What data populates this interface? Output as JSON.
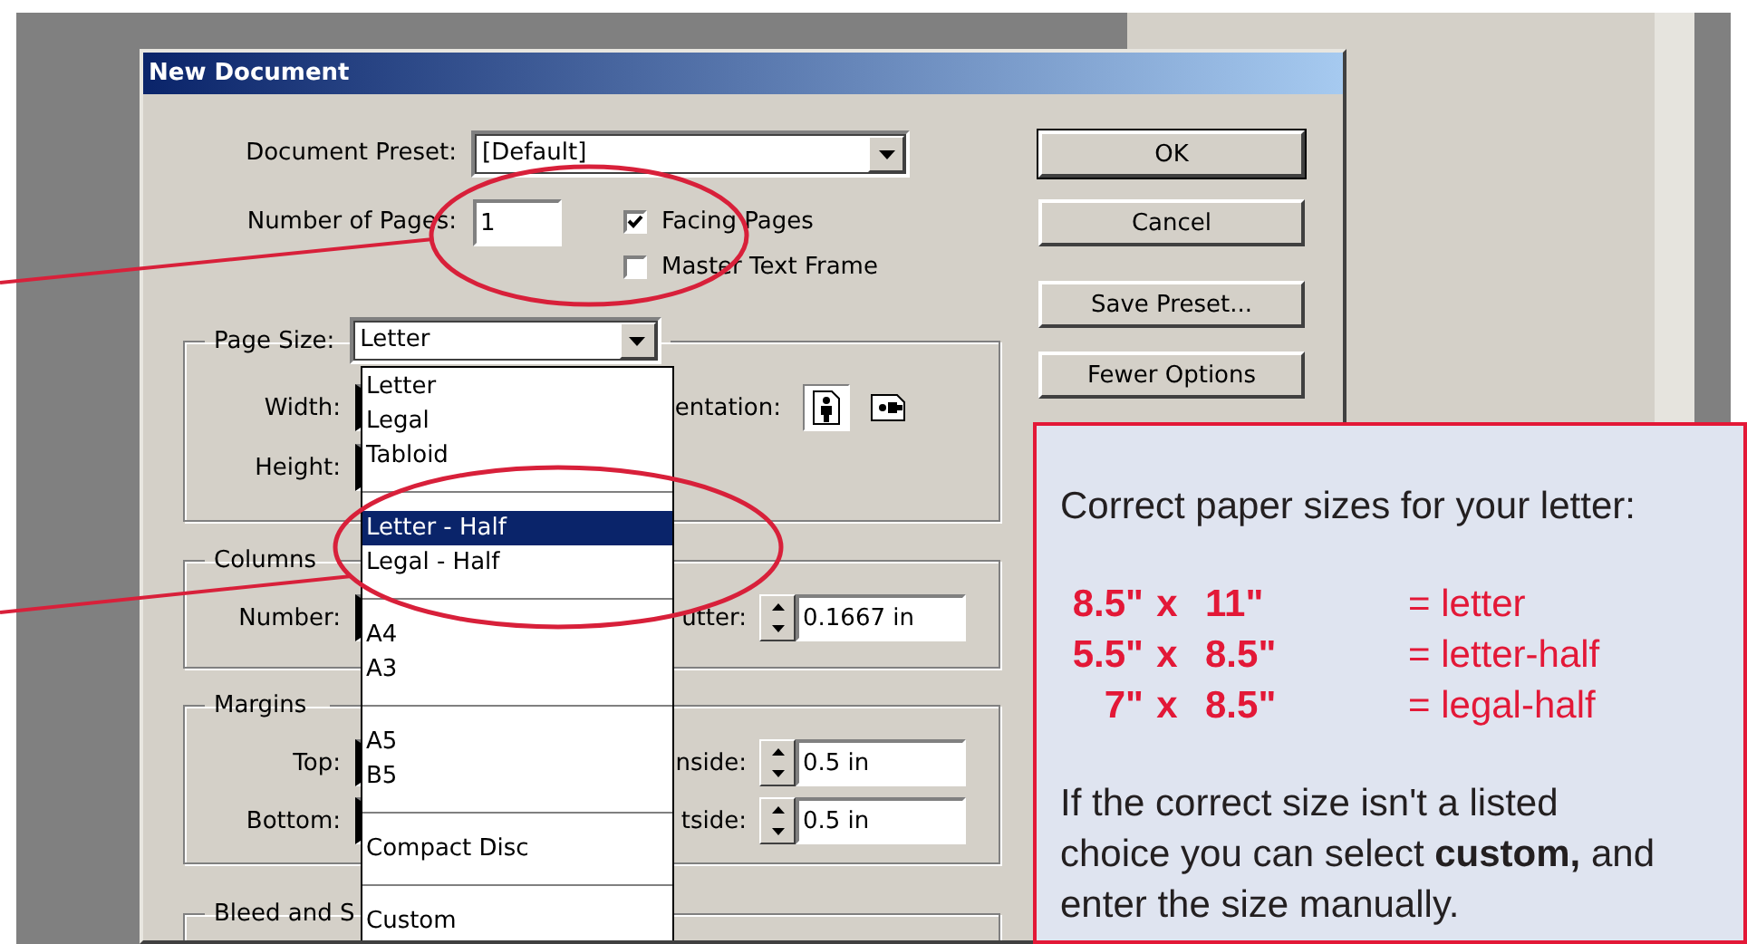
{
  "dialog": {
    "title": "New Document",
    "preset": {
      "label": "Document Preset:",
      "value": "[Default]"
    },
    "pages": {
      "label": "Number of Pages:",
      "value": "1"
    },
    "checkboxes": [
      {
        "label": "Facing Pages",
        "checked": true
      },
      {
        "label": "Master Text Frame",
        "checked": false
      }
    ],
    "page_size": {
      "label": "Page Size:",
      "value": "Letter",
      "rows": [
        {
          "label": "Width:"
        },
        {
          "label": "Height:"
        }
      ],
      "orientation_label": "entation:",
      "orientation": [
        {
          "kind": "portrait",
          "selected": true
        },
        {
          "kind": "landscape",
          "selected": false
        }
      ]
    },
    "columns": {
      "title": "Columns",
      "number_label": "Number:",
      "gutter_label": "utter:",
      "gutter": "0.1667 in"
    },
    "margins": {
      "title": "Margins",
      "rows": [
        {
          "label": "Top:",
          "side_label": "nside:",
          "value": "0.5 in"
        },
        {
          "label": "Bottom:",
          "side_label": "tside:",
          "value": "0.5 in"
        }
      ]
    },
    "bleed": {
      "title": "Bleed and S"
    },
    "buttons": [
      {
        "label": "OK",
        "default": true
      },
      {
        "label": "Cancel",
        "default": false
      },
      {
        "label": "Save Preset...",
        "default": false
      },
      {
        "label": "Fewer Options",
        "default": false
      }
    ],
    "page_size_menu": [
      {
        "kind": "item",
        "label": "Letter",
        "selected": false
      },
      {
        "kind": "item",
        "label": "Legal",
        "selected": false
      },
      {
        "kind": "item",
        "label": "Tabloid",
        "selected": false
      },
      {
        "kind": "separator"
      },
      {
        "kind": "item",
        "label": "Letter - Half",
        "selected": true
      },
      {
        "kind": "item",
        "label": "Legal - Half",
        "selected": false
      },
      {
        "kind": "separator"
      },
      {
        "kind": "item",
        "label": "A4",
        "selected": false
      },
      {
        "kind": "item",
        "label": "A3",
        "selected": false
      },
      {
        "kind": "separator"
      },
      {
        "kind": "item",
        "label": "A5",
        "selected": false
      },
      {
        "kind": "item",
        "label": "B5",
        "selected": false
      },
      {
        "kind": "separator"
      },
      {
        "kind": "item",
        "label": "Compact Disc",
        "selected": false
      },
      {
        "kind": "separator"
      },
      {
        "kind": "item",
        "label": "Custom",
        "selected": false
      }
    ]
  },
  "callout": {
    "heading": "Correct paper sizes for your letter:",
    "sizes": [
      {
        "width": "8.5\"",
        "times": "x",
        "height": "11\"",
        "meaning": "= letter"
      },
      {
        "width": "5.5\"",
        "times": "x",
        "height": "8.5\"",
        "meaning": "= letter-half"
      },
      {
        "width": "7\"",
        "times": "x",
        "height": "8.5\"",
        "meaning": "= legal-half"
      }
    ],
    "note": "If the correct size isn't a listed choice you can select **custom,** and enter the size manually."
  }
}
